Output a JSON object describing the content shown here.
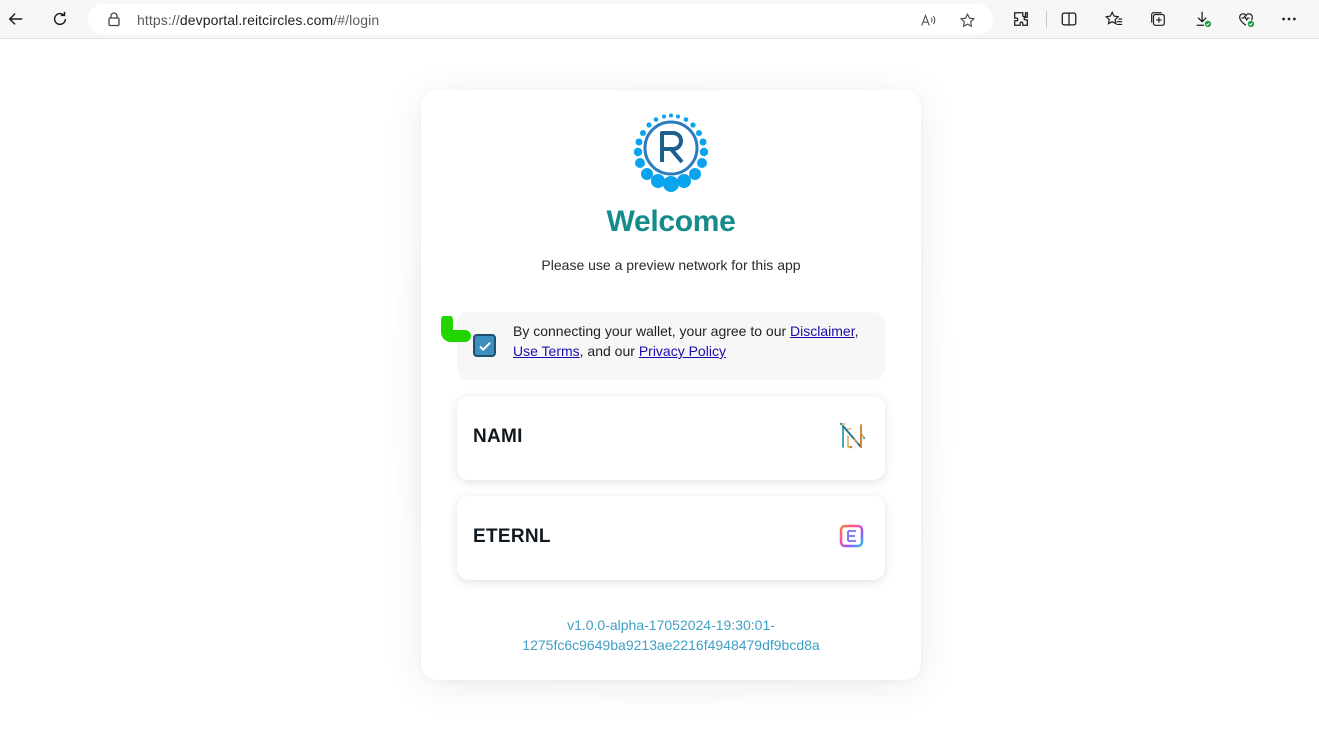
{
  "browser": {
    "url_prefix": "https://",
    "url_host": "devportal.reitcircles.com",
    "url_path": "/#/login"
  },
  "page": {
    "title": "Welcome",
    "subtitle": "Please use a preview network for this app",
    "consent": {
      "text_before": "By connecting your wallet, your agree to our ",
      "disclaimer_link": "Disclaimer",
      "sep1": ",",
      "use_terms_link": "Use Terms",
      "text_middle": ", and our ",
      "privacy_link": "Privacy Policy",
      "checked": true
    },
    "wallets": [
      {
        "label": "NAMI",
        "icon": "nami-icon"
      },
      {
        "label": "ETERNL",
        "icon": "eternl-icon"
      }
    ],
    "version_line1": "v1.0.0-alpha-17052024-19:30:01-",
    "version_line2": "1275fc6c9649ba9213ae2216f4948479df9bcd8a"
  },
  "colors": {
    "brand_teal": "#168b8b",
    "link_blue": "#1a0dab",
    "version_blue": "#3fa0c4",
    "checkbox_blue": "#3c8fbf",
    "cursor_green": "#22d400"
  }
}
